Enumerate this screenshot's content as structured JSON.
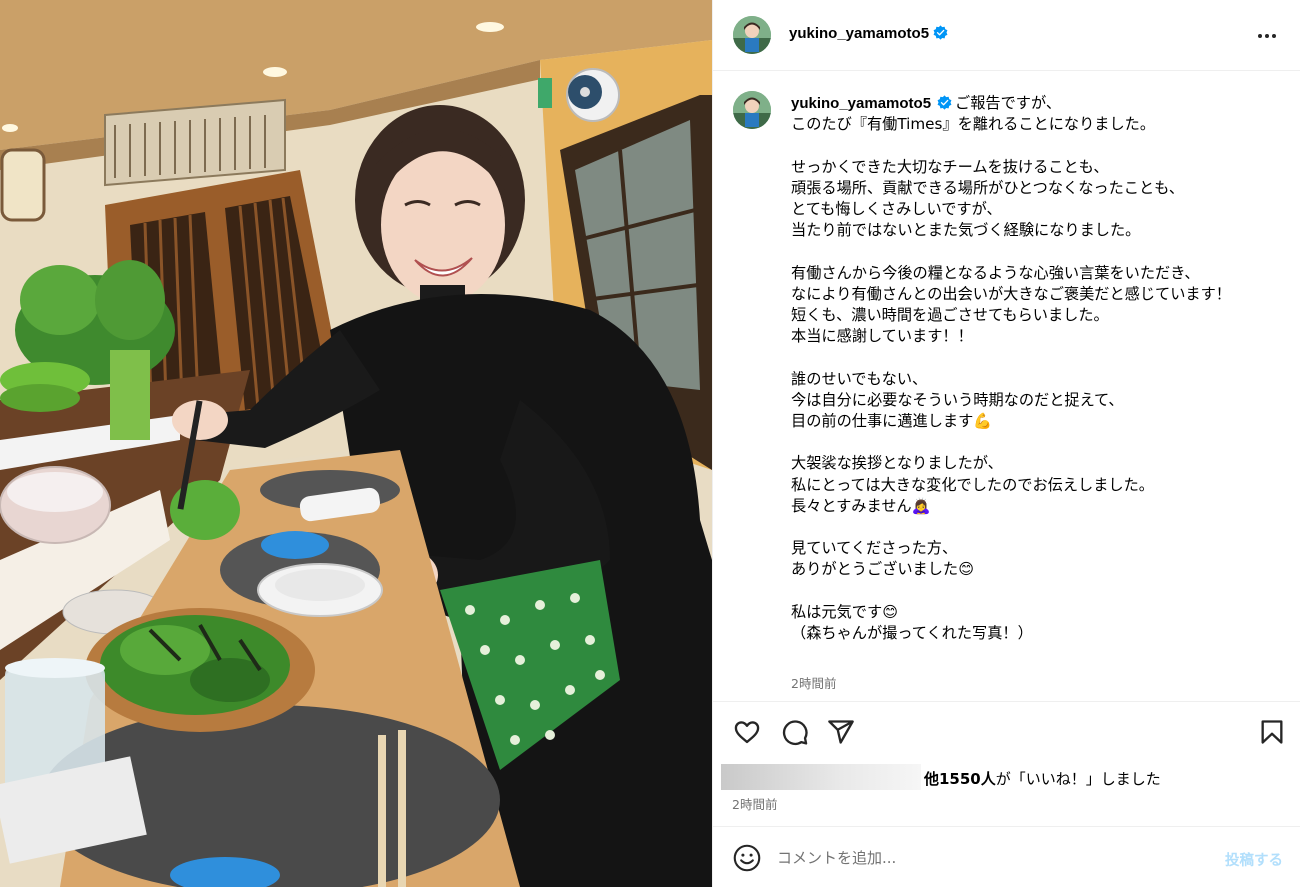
{
  "post": {
    "username": "yukino_yamamoto5",
    "verified": true,
    "more_icon": "more-horizontal-icon",
    "caption": "ご報告ですが、\nこのたび『有働Times』を離れることになりました。\n\nせっかくできた大切なチームを抜けることも、\n頑張る場所、貢献できる場所がひとつなくなったことも、\nとても悔しくさみしいですが、\n当たり前ではないとまた気づく経験になりました。\n\n有働さんから今後の糧となるような心強い言葉をいただき、\nなにより有働さんとの出会いが大きなご褒美だと感じています！\n短くも、濃い時間を過ごさせてもらいました。\n本当に感謝しています！！\n\n誰のせいでもない、\n今は自分に必要なそういう時期なのだと捉えて、\n目の前の仕事に邁進します💪\n\n大袈裟な挨拶となりましたが、\n私にとっては大きな変化でしたのでお伝えしました。\n長々とすみません🙇‍♀️\n\n見ていてくださった方、\nありがとうございました😊\n\n私は元気です😊\n（森ちゃんが撮ってくれた写真！）",
    "caption_time": "2時間前",
    "likes_count": "他1550人",
    "likes_suffix": "が「いいね！」しました",
    "post_time": "2時間前"
  },
  "actions": {
    "like_icon": "heart-icon",
    "comment_icon": "comment-icon",
    "share_icon": "share-icon",
    "save_icon": "bookmark-icon"
  },
  "comment": {
    "placeholder": "コメントを追加...",
    "post_label": "投稿する",
    "emoji_icon": "emoji-icon"
  },
  "colors": {
    "verified": "#0095f6",
    "muted_text": "#737373",
    "post_button_disabled": "#b2dffc",
    "divider": "#efefef"
  }
}
